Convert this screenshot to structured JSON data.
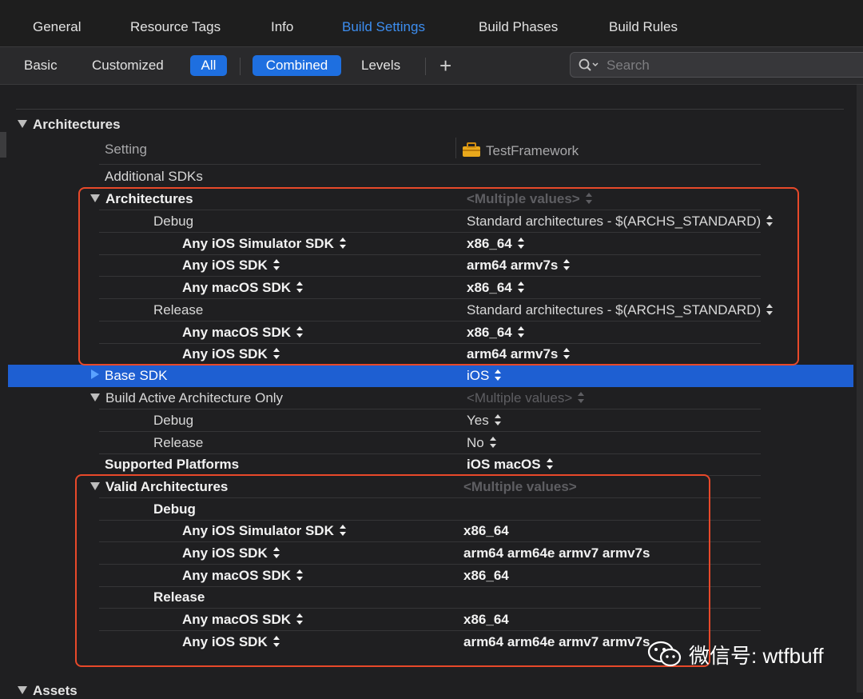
{
  "tabs": {
    "general": "General",
    "resource_tags": "Resource Tags",
    "info": "Info",
    "build_settings": "Build Settings",
    "build_phases": "Build Phases",
    "build_rules": "Build Rules"
  },
  "filters": {
    "basic": "Basic",
    "customized": "Customized",
    "all": "All",
    "combined": "Combined",
    "levels": "Levels",
    "add": "+"
  },
  "search": {
    "placeholder": "Search"
  },
  "section": {
    "title": "Architectures",
    "next_title": "Assets"
  },
  "header": {
    "setting": "Setting",
    "target": "TestFramework"
  },
  "rows": {
    "additional_sdks": "Additional SDKs",
    "architectures": {
      "label": "Architectures",
      "value": "<Multiple values>"
    },
    "arch_debug": {
      "label": "Debug",
      "value": "Standard architectures  -  $(ARCHS_STANDARD)"
    },
    "arch_debug_sim": {
      "label": "Any iOS Simulator SDK",
      "value": "x86_64"
    },
    "arch_debug_ios": {
      "label": "Any iOS SDK",
      "value": "arm64 armv7s"
    },
    "arch_debug_mac": {
      "label": "Any macOS SDK",
      "value": "x86_64"
    },
    "arch_release": {
      "label": "Release",
      "value": "Standard architectures  -  $(ARCHS_STANDARD)"
    },
    "arch_release_mac": {
      "label": "Any macOS SDK",
      "value": "x86_64"
    },
    "arch_release_ios": {
      "label": "Any iOS SDK",
      "value": "arm64 armv7s"
    },
    "base_sdk": {
      "label": "Base SDK",
      "value": "iOS"
    },
    "baao": {
      "label": "Build Active Architecture Only",
      "value": "<Multiple values>"
    },
    "baao_debug": {
      "label": "Debug",
      "value": "Yes"
    },
    "baao_release": {
      "label": "Release",
      "value": "No"
    },
    "supported_platforms": {
      "label": "Supported Platforms",
      "value": "iOS macOS"
    },
    "valid_archs": {
      "label": "Valid Architectures",
      "value": "<Multiple values>"
    },
    "va_debug": {
      "label": "Debug"
    },
    "va_debug_sim": {
      "label": "Any iOS Simulator SDK",
      "value": "x86_64"
    },
    "va_debug_ios": {
      "label": "Any iOS SDK",
      "value": "arm64 arm64e armv7 armv7s"
    },
    "va_debug_mac": {
      "label": "Any macOS SDK",
      "value": "x86_64"
    },
    "va_release": {
      "label": "Release"
    },
    "va_release_mac": {
      "label": "Any macOS SDK",
      "value": "x86_64"
    },
    "va_release_ios": {
      "label": "Any iOS SDK",
      "value": "arm64 arm64e armv7 armv7s"
    }
  },
  "watermark": "微信号: wtfbuff",
  "colors": {
    "accent": "#3d8ef0",
    "selection": "#1e5fd2",
    "highlight_box": "#e8492a",
    "background": "#1f1f21"
  }
}
